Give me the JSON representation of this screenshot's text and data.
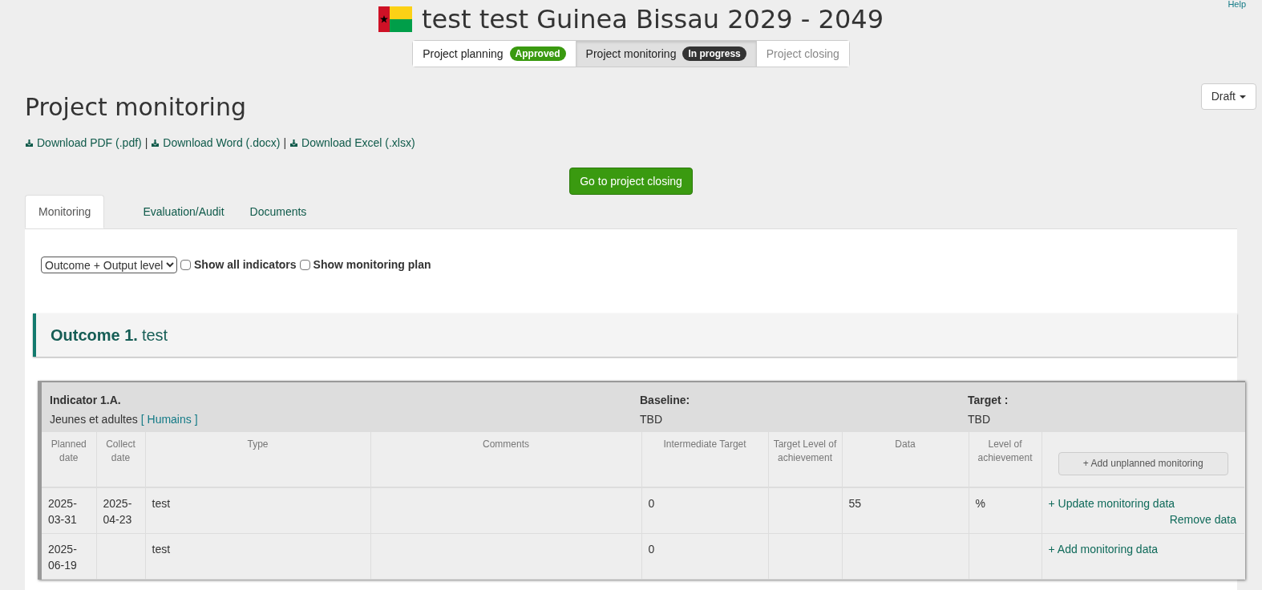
{
  "header_link": "Help",
  "title": "test test Guinea Bissau 2029 - 2049",
  "stages": [
    {
      "label": "Project planning",
      "badge": {
        "text": "Approved",
        "color": "#3a9a10"
      },
      "selected": false,
      "disabled": false
    },
    {
      "label": "Project monitoring",
      "badge": {
        "text": "In progress",
        "color": "#333333"
      },
      "selected": true,
      "disabled": false
    },
    {
      "label": "Project closing",
      "selected": false,
      "disabled": true
    }
  ],
  "status_dropdown": "Draft",
  "page_title": "Project monitoring",
  "downloads": [
    "Download PDF (.pdf)",
    "Download Word (.docx)",
    "Download Excel (.xlsx)"
  ],
  "download_separator": "|",
  "primary_button": "Go to project closing",
  "tabs": [
    {
      "label": "Monitoring",
      "selected": true
    },
    {
      "label": "Evaluation/Audit",
      "selected": false
    },
    {
      "label": "Documents",
      "selected": false
    }
  ],
  "filters": {
    "level_select": "Outcome + Output level",
    "checkboxes": [
      {
        "label": "Show all indicators",
        "checked": false
      },
      {
        "label": "Show monitoring plan",
        "checked": false
      }
    ]
  },
  "outcome": {
    "number": "Outcome 1.",
    "title": "test"
  },
  "indicator": {
    "code": "Indicator 1.A.",
    "description": "Jeunes et adultes",
    "tag": "[ Humains ]",
    "baseline_label": "Baseline:",
    "baseline": "TBD",
    "target_label": "Target :",
    "target": "TBD"
  },
  "table": {
    "columns": [
      "Planned date",
      "Collect date",
      "Type",
      "Comments",
      "Intermediate Target",
      "Target Level of achievement",
      "Data",
      "Level of achievement"
    ],
    "add_button": "+ Add unplanned monitoring",
    "rows": [
      {
        "cells": [
          "2025-03-31",
          "2025-04-23",
          "test",
          "",
          "0",
          "",
          "55",
          "%"
        ],
        "actions": [
          "+ Update monitoring data",
          "Remove data"
        ]
      },
      {
        "cells": [
          "2025-06-19",
          "",
          "test",
          "",
          "0",
          "",
          "",
          ""
        ],
        "actions": [
          "+ Add monitoring data"
        ]
      }
    ]
  }
}
